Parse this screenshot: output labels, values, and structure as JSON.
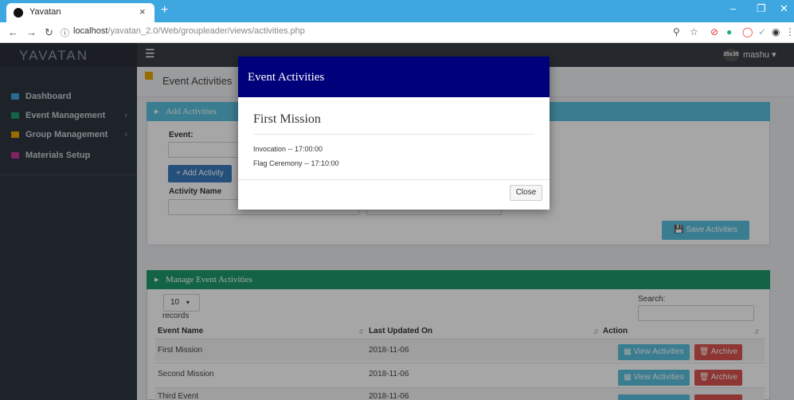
{
  "browser": {
    "tab_title": "Yavatan",
    "tab_close": "×",
    "new_tab": "+",
    "url_host": "localhost",
    "url_path": "/yavatan_2.0/Web/groupleader/views/activities.php",
    "url_info": "ⓘ"
  },
  "app": {
    "logo": "YAVATAN",
    "user": "mashu",
    "avatar_text": "35x35"
  },
  "sidebar": {
    "items": [
      {
        "label": "Dashboard",
        "color": "#3ea7e0"
      },
      {
        "label": "Event Management",
        "color": "#1e9a6b"
      },
      {
        "label": "Group Management",
        "color": "#e8a500"
      },
      {
        "label": "Materials Setup",
        "color": "#c8379a"
      }
    ]
  },
  "page": {
    "title": "Event Activities"
  },
  "add_panel": {
    "title": "Add Activities",
    "event_label": "Event:",
    "add_button": "Add Activity",
    "activity_name_label": "Activity Name",
    "save_button": "Save Activities",
    "color": "#5bc0de"
  },
  "manage_panel": {
    "title": "Manage Event Activities",
    "color": "#1e9a6b",
    "page_size": "10",
    "records_label": "records",
    "search_label": "Search:",
    "columns": [
      "Event Name",
      "Last Updated On",
      "Action"
    ],
    "rows": [
      {
        "event": "First Mission",
        "updated": "2018-11-06"
      },
      {
        "event": "Second Mission",
        "updated": "2018-11-06"
      },
      {
        "event": "Third Event",
        "updated": "2018-11-06"
      }
    ],
    "view_button": "View Activities",
    "archive_button": "Archive"
  },
  "modal": {
    "title": "Event Activities",
    "event_name": "First Mission",
    "activities": [
      "Invocation -- 17:00:00",
      "Flag Ceremony -- 17:10:00"
    ],
    "close_button": "Close",
    "header_color": "#00007a"
  }
}
